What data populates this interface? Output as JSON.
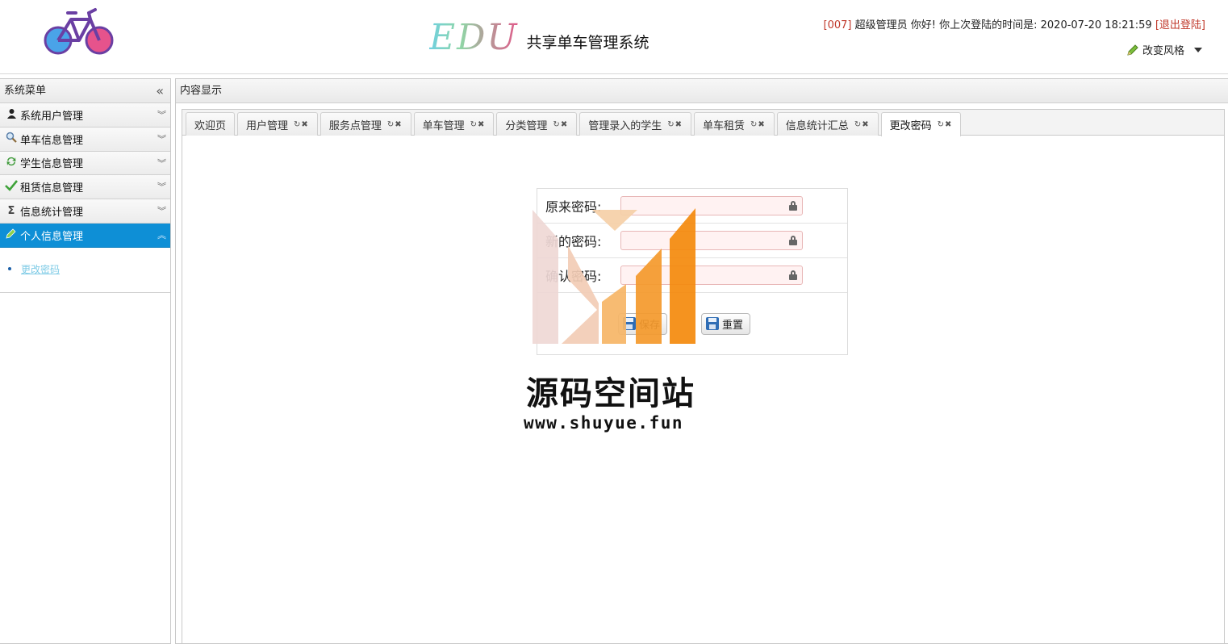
{
  "header": {
    "brand_edu": "EDU",
    "brand_subtitle": "共享单车管理系统",
    "user_id": "[007]",
    "user_greeting": "超级管理员 你好! 你上次登陆的时间是: 2020-07-20 18:21:59",
    "logout": "[退出登陆]",
    "style_switch": "改变风格"
  },
  "sidebar": {
    "title": "系统菜单",
    "items": [
      {
        "label": "系统用户管理",
        "icon": "user-icon"
      },
      {
        "label": "单车信息管理",
        "icon": "search-icon"
      },
      {
        "label": "学生信息管理",
        "icon": "refresh-icon"
      },
      {
        "label": "租赁信息管理",
        "icon": "check-icon"
      },
      {
        "label": "信息统计管理",
        "icon": "sigma-icon"
      },
      {
        "label": "个人信息管理",
        "icon": "pencil-icon"
      }
    ],
    "submenu": [
      "更改密码"
    ]
  },
  "content": {
    "title": "内容显示",
    "tabs": [
      {
        "label": "欢迎页"
      },
      {
        "label": "用户管理"
      },
      {
        "label": "服务点管理"
      },
      {
        "label": "单车管理"
      },
      {
        "label": "分类管理"
      },
      {
        "label": "管理录入的学生"
      },
      {
        "label": "单车租赁"
      },
      {
        "label": "信息统计汇总"
      },
      {
        "label": "更改密码"
      }
    ],
    "form": {
      "old_password_label": "原来密码:",
      "new_password_label": "新的密码:",
      "confirm_password_label": "确认密码:",
      "save_label": "保存",
      "reset_label": "重置"
    }
  },
  "watermark": {
    "title": "源码空间站",
    "url": "www.shuyue.fun"
  },
  "colors": {
    "active_menu": "#0e8fd6",
    "link": "#7ecbe6",
    "alert_red": "#c0392b",
    "field_bg": "#fff2f2"
  }
}
